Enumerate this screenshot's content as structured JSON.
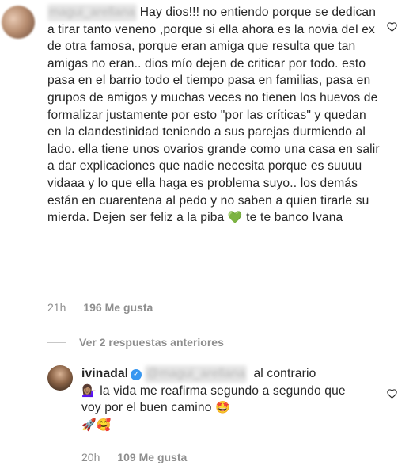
{
  "comment1": {
    "username": "magui_arellana",
    "text": "Hay dios!!! no entiendo porque se dedican a tirar tanto veneno ,porque si ella ahora es la novia del ex de otra famosa, porque eran amiga que resulta que tan amigas no eran.. dios mío dejen de criticar por todo. esto pasa en el barrio todo el tiempo pasa en familias, pasa en grupos de amigos y muchas veces no tienen los huevos de formalizar justamente por esto \"por las críticas\" y quedan en la clandestinidad teniendo a sus parejas durmiendo al lado. ella tiene unos ovarios grande como una casa en salir a dar explicaciones que nadie necesita porque es suuuu vidaaa y lo que ella haga es problema suyo.. los demás están en cuarentena al pedo y no saben a quien tirarle su mierda. Dejen ser feliz a la piba",
    "emoji": "💚",
    "tail": " te te banco Ivana",
    "time": "21h",
    "likes": "196",
    "likes_label": "Me gusta"
  },
  "replies_link": "Ver 2 respuestas anteriores",
  "comment2": {
    "username": "ivinadal",
    "verified_icon": "✓",
    "mention": "@magui_arellana",
    "text_part1": " al contrario",
    "emoji_woman": "💁🏽‍♀️",
    "text_part2": " la vida me reafirma segundo a segundo que voy por el buen camino ",
    "emoji_starstruck": "🤩",
    "emoji_rocket": "🚀",
    "emoji_smiling_hearts": "🥰",
    "time": "20h",
    "likes": "109",
    "likes_label": "Me gusta"
  },
  "colors": {
    "text": "#262626",
    "meta": "#8e8e8e",
    "verified": "#3897f0",
    "heart_green": "#2fbf4a"
  }
}
